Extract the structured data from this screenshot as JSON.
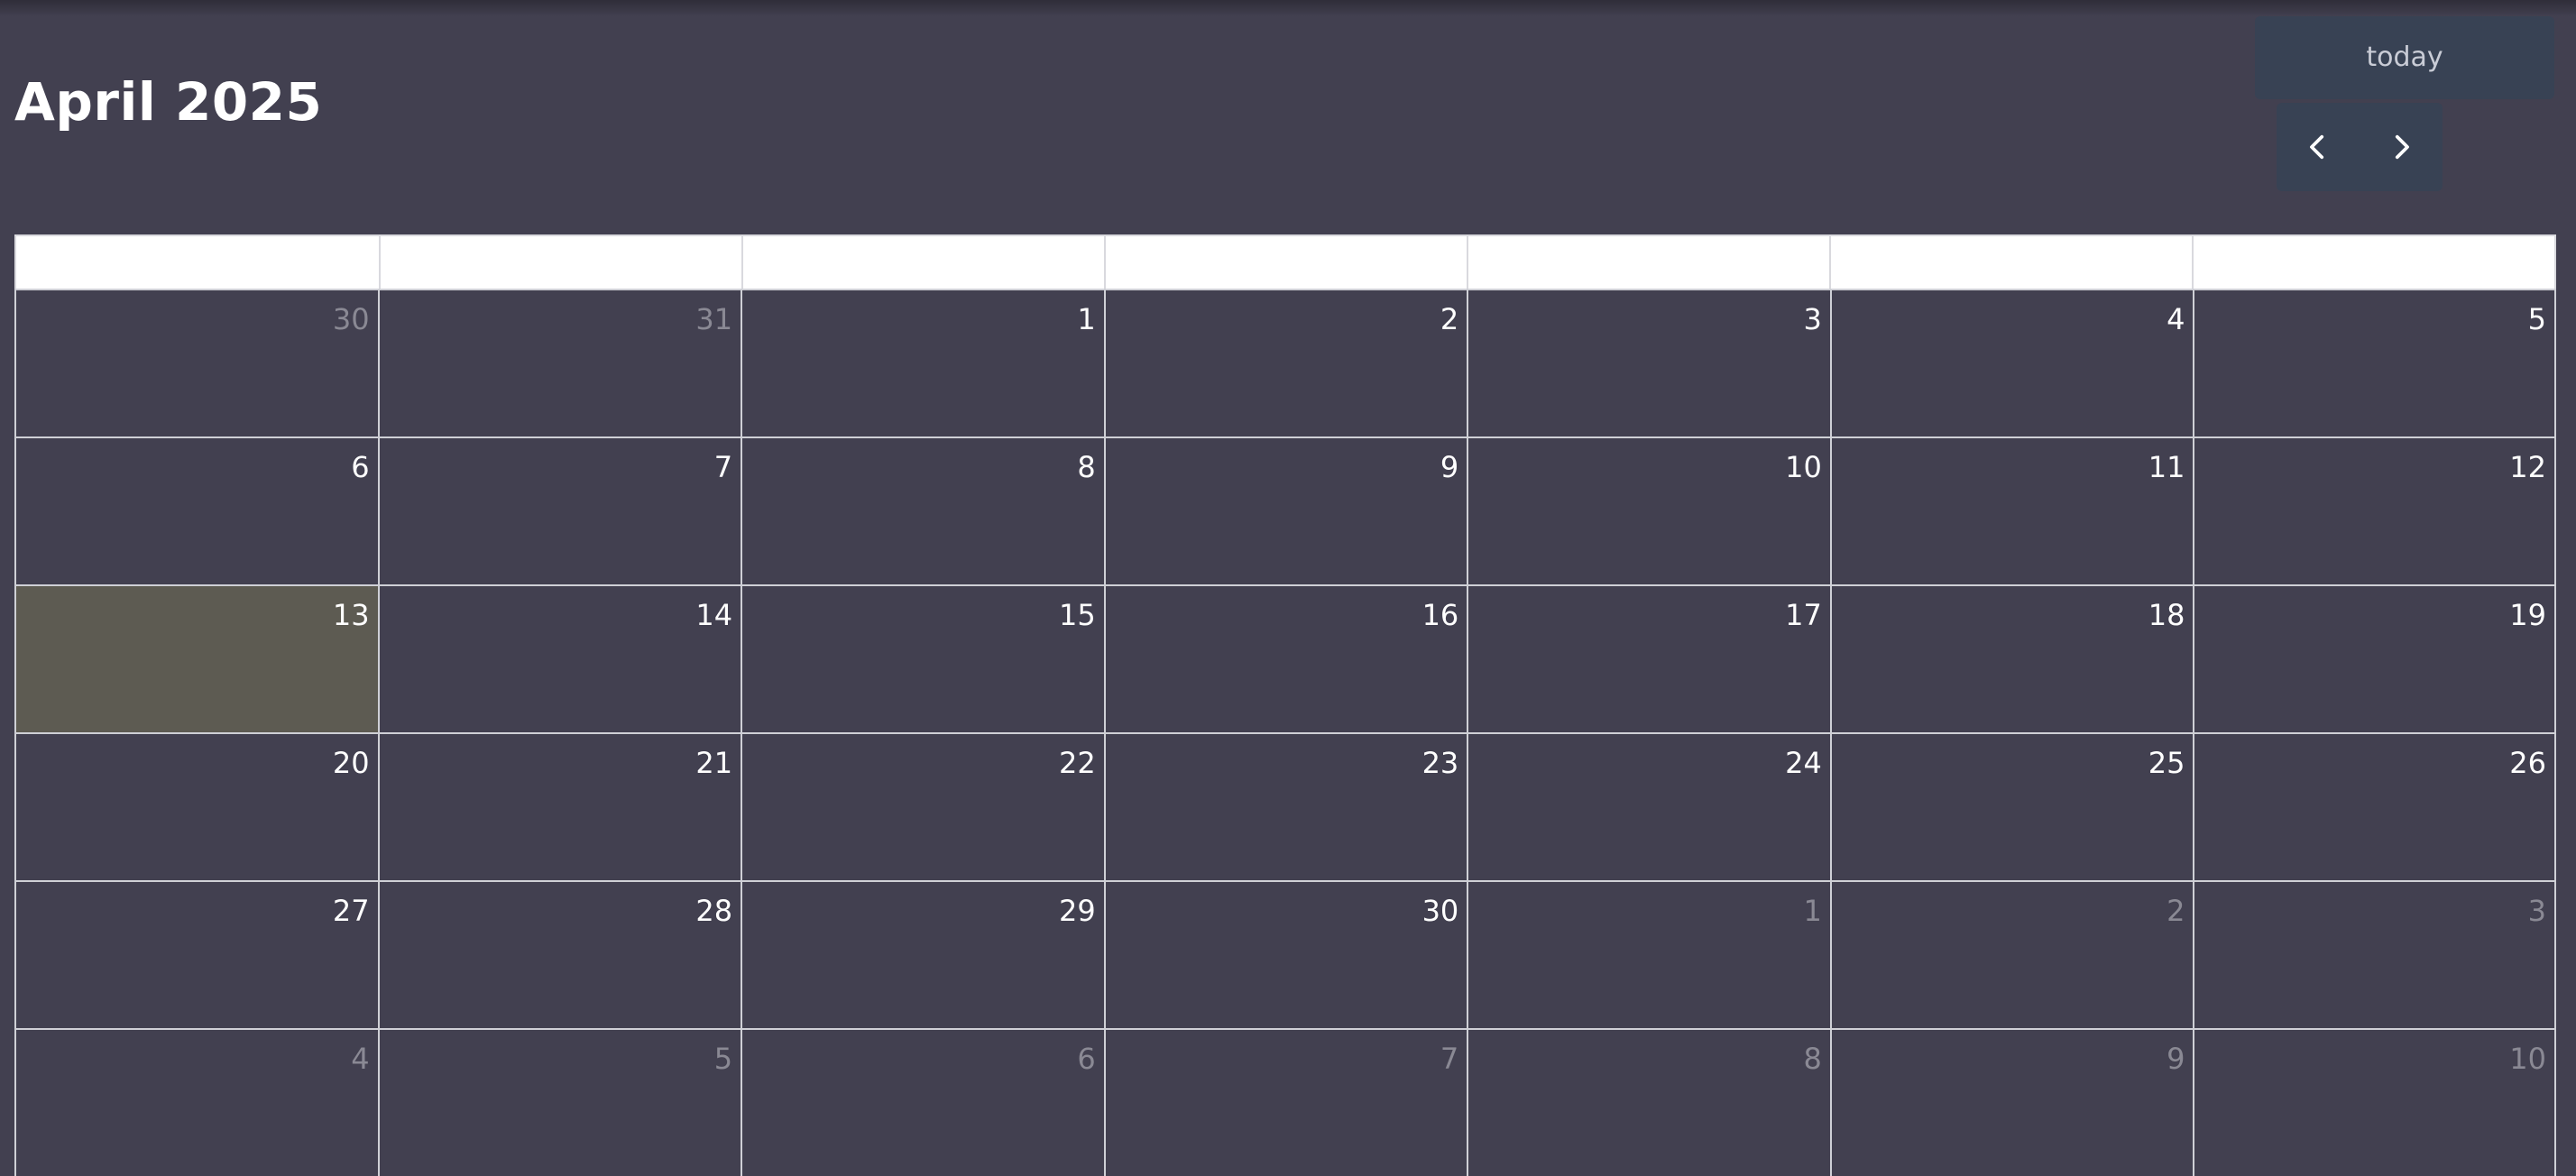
{
  "calendar": {
    "title": "April 2025",
    "today_label": "today",
    "prev_icon": "chevron-left-icon",
    "next_icon": "chevron-right-icon",
    "weekday_headers": [
      "",
      "",
      "",
      "",
      "",
      "",
      ""
    ],
    "weeks": [
      [
        {
          "n": "30",
          "other": true
        },
        {
          "n": "31",
          "other": true
        },
        {
          "n": "1"
        },
        {
          "n": "2"
        },
        {
          "n": "3"
        },
        {
          "n": "4"
        },
        {
          "n": "5"
        }
      ],
      [
        {
          "n": "6"
        },
        {
          "n": "7"
        },
        {
          "n": "8"
        },
        {
          "n": "9"
        },
        {
          "n": "10"
        },
        {
          "n": "11"
        },
        {
          "n": "12"
        }
      ],
      [
        {
          "n": "13",
          "today": true
        },
        {
          "n": "14"
        },
        {
          "n": "15"
        },
        {
          "n": "16"
        },
        {
          "n": "17"
        },
        {
          "n": "18"
        },
        {
          "n": "19"
        }
      ],
      [
        {
          "n": "20"
        },
        {
          "n": "21"
        },
        {
          "n": "22"
        },
        {
          "n": "23"
        },
        {
          "n": "24"
        },
        {
          "n": "25"
        },
        {
          "n": "26"
        }
      ],
      [
        {
          "n": "27"
        },
        {
          "n": "28"
        },
        {
          "n": "29"
        },
        {
          "n": "30"
        },
        {
          "n": "1",
          "other": true
        },
        {
          "n": "2",
          "other": true
        },
        {
          "n": "3",
          "other": true
        }
      ],
      [
        {
          "n": "4",
          "other": true
        },
        {
          "n": "5",
          "other": true
        },
        {
          "n": "6",
          "other": true
        },
        {
          "n": "7",
          "other": true
        },
        {
          "n": "8",
          "other": true
        },
        {
          "n": "9",
          "other": true
        },
        {
          "n": "10",
          "other": true
        }
      ]
    ],
    "colors": {
      "background": "#424050",
      "today_highlight": "#5d5b52",
      "button_bg": "#384254",
      "other_month_text": "#8a8994"
    }
  }
}
